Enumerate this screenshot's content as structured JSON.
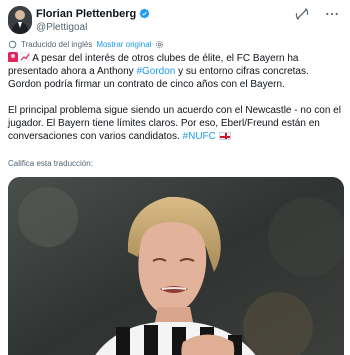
{
  "author": {
    "display_name": "Florian Plettenberg",
    "handle": "@Plettigoal",
    "verified": true
  },
  "header_icons": [
    "grok-icon",
    "more-icon"
  ],
  "translation": {
    "label": "Traducido del inglés",
    "show_original": "Mostrar original"
  },
  "tweet": {
    "p1_text": " A pesar del interés de otros clubes de élite, el FC Bayern ha presentado ahora a Anthony ",
    "p1_hashtag": "#Gordon",
    "p1_rest": " y su entorno cifras concretas. Gordon podría firmar un contrato de cinco años con el Bayern.",
    "p2_text": "El principal problema sigue siendo un acuerdo con el Newcastle - no con el jugador. El Bayern tiene límites claros. Por eso, Eberl/Freund están en conversaciones con varios candidatos. ",
    "p2_hashtag": "#NUFC"
  },
  "rate_translation": "Califica esta traducción:",
  "colors": {
    "text": "#0f1419",
    "secondary": "#536471",
    "link": "#1d9bf0",
    "verified": "#1d9bf0"
  }
}
